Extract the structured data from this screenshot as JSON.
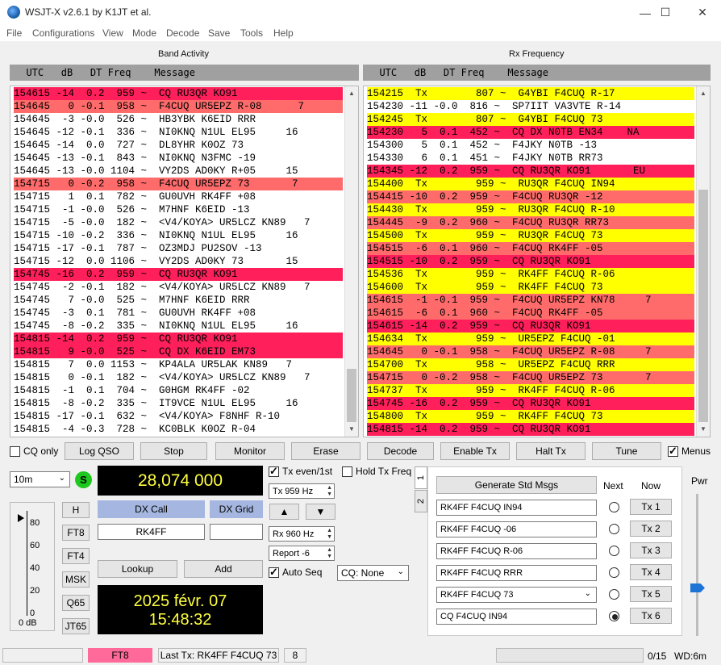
{
  "window": {
    "title": "WSJT-X   v2.6.1   by K1JT et al."
  },
  "menu": [
    "File",
    "Configurations",
    "View",
    "Mode",
    "Decode",
    "Save",
    "Tools",
    "Help"
  ],
  "band_activity": {
    "title": "Band Activity",
    "header": "  UTC   dB   DT Freq    Message",
    "rows": [
      {
        "text": "154615 -14  0.2  959 ~  CQ RU3QR KO91",
        "bg": "#ff1f5a"
      },
      {
        "text": "154645   0 -0.1  958 ~  F4CUQ UR5EPZ R-08      7",
        "bg": "#ff6b6b"
      },
      {
        "text": "154645  -3 -0.0  526 ~  HB3YBK K6EID RRR",
        "bg": "#ffffff"
      },
      {
        "text": "154645 -12 -0.1  336 ~  NI0KNQ N1UL EL95     16",
        "bg": "#ffffff"
      },
      {
        "text": "154645 -14  0.0  727 ~  DL8YHR K0OZ 73",
        "bg": "#ffffff"
      },
      {
        "text": "154645 -13 -0.1  843 ~  NI0KNQ N3FMC -19",
        "bg": "#ffffff"
      },
      {
        "text": "154645 -13 -0.0 1104 ~  VY2DS AD0KY R+05     15",
        "bg": "#ffffff"
      },
      {
        "text": "154715   0 -0.2  958 ~  F4CUQ UR5EPZ 73       7",
        "bg": "#ff6b6b"
      },
      {
        "text": "154715   1  0.1  782 ~  GU0UVH RK4FF +08",
        "bg": "#ffffff"
      },
      {
        "text": "154715  -1 -0.0  526 ~  M7HNF K6EID -13",
        "bg": "#ffffff"
      },
      {
        "text": "154715  -5 -0.0  182 ~  <V4/KOYA> UR5LCZ KN89   7",
        "bg": "#ffffff"
      },
      {
        "text": "154715 -10 -0.2  336 ~  NI0KNQ N1UL EL95     16",
        "bg": "#ffffff"
      },
      {
        "text": "154715 -17 -0.1  787 ~  OZ3MDJ PU2SOV -13",
        "bg": "#ffffff"
      },
      {
        "text": "154715 -12  0.0 1106 ~  VY2DS AD0KY 73       15",
        "bg": "#ffffff"
      },
      {
        "text": "154745 -16  0.2  959 ~  CQ RU3QR KO91",
        "bg": "#ff1f5a"
      },
      {
        "text": "154745  -2 -0.1  182 ~  <V4/KOYA> UR5LCZ KN89   7",
        "bg": "#ffffff"
      },
      {
        "text": "154745   7 -0.0  525 ~  M7HNF K6EID RRR",
        "bg": "#ffffff"
      },
      {
        "text": "154745  -3  0.1  781 ~  GU0UVH RK4FF +08",
        "bg": "#ffffff"
      },
      {
        "text": "154745  -8 -0.2  335 ~  NI0KNQ N1UL EL95     16",
        "bg": "#ffffff"
      },
      {
        "text": "154815 -14  0.2  959 ~  CQ RU3QR KO91",
        "bg": "#ff1f5a"
      },
      {
        "text": "154815   9 -0.0  525 ~  CQ DX K6EID EM73",
        "bg": "#ff1f5a"
      },
      {
        "text": "154815   7  0.0 1153 ~  KP4ALA UR5LAK KN89   7",
        "bg": "#ffffff"
      },
      {
        "text": "154815   0 -0.1  182 ~  <V4/KOYA> UR5LCZ KN89   7",
        "bg": "#ffffff"
      },
      {
        "text": "154815  -1  0.1  704 ~  G0HGM RK4FF -02",
        "bg": "#ffffff"
      },
      {
        "text": "154815  -8 -0.2  335 ~  IT9VCE N1UL EL95     16",
        "bg": "#ffffff"
      },
      {
        "text": "154815 -17 -0.1  632 ~  <V4/KOYA> F8NHF R-10",
        "bg": "#ffffff"
      },
      {
        "text": "154815  -4 -0.3  728 ~  KC0BLK K0OZ R-04",
        "bg": "#ffffff"
      }
    ]
  },
  "rx_frequency": {
    "title": "Rx Frequency",
    "header": "  UTC   dB   DT Freq    Message",
    "rows": [
      {
        "text": "154215  Tx        807 ~  G4YBI F4CUQ R-17",
        "bg": "#ffff00"
      },
      {
        "text": "154230 -11 -0.0  816 ~  SP7IIT VA3VTE R-14",
        "bg": "#ffffff"
      },
      {
        "text": "154245  Tx        807 ~  G4YBI F4CUQ 73",
        "bg": "#ffff00"
      },
      {
        "text": "154230   5  0.1  452 ~  CQ DX N0TB EN34    NA",
        "bg": "#ff1f5a"
      },
      {
        "text": "154300   5  0.1  452 ~  F4JKY N0TB -13",
        "bg": "#ffffff"
      },
      {
        "text": "154330   6  0.1  451 ~  F4JKY N0TB RR73",
        "bg": "#ffffff"
      },
      {
        "text": "154345 -12  0.2  959 ~  CQ RU3QR KO91       EU",
        "bg": "#ff1f5a"
      },
      {
        "text": "154400  Tx        959 ~  RU3QR F4CUQ IN94",
        "bg": "#ffff00"
      },
      {
        "text": "154415 -10  0.2  959 ~  F4CUQ RU3QR -12",
        "bg": "#ff6b6b"
      },
      {
        "text": "154430  Tx        959 ~  RU3QR F4CUQ R-10",
        "bg": "#ffff00"
      },
      {
        "text": "154445  -9  0.2  960 ~  F4CUQ RU3QR RR73",
        "bg": "#ff6b6b"
      },
      {
        "text": "154500  Tx        959 ~  RU3QR F4CUQ 73",
        "bg": "#ffff00"
      },
      {
        "text": "154515  -6  0.1  960 ~  F4CUQ RK4FF -05",
        "bg": "#ff6b6b"
      },
      {
        "text": "154515 -10  0.2  959 ~  CQ RU3QR KO91",
        "bg": "#ff1f5a"
      },
      {
        "text": "154536  Tx        959 ~  RK4FF F4CUQ R-06",
        "bg": "#ffff00"
      },
      {
        "text": "154600  Tx        959 ~  RK4FF F4CUQ 73",
        "bg": "#ffff00"
      },
      {
        "text": "154615  -1 -0.1  959 ~  F4CUQ UR5EPZ KN78     7",
        "bg": "#ff6b6b"
      },
      {
        "text": "154615  -6  0.1  960 ~  F4CUQ RK4FF -05",
        "bg": "#ff6b6b"
      },
      {
        "text": "154615 -14  0.2  959 ~  CQ RU3QR KO91",
        "bg": "#ff1f5a"
      },
      {
        "text": "154634  Tx        959 ~  UR5EPZ F4CUQ -01",
        "bg": "#ffff00"
      },
      {
        "text": "154645   0 -0.1  958 ~  F4CUQ UR5EPZ R-08     7",
        "bg": "#ff6b6b"
      },
      {
        "text": "154700  Tx        958 ~  UR5EPZ F4CUQ RRR",
        "bg": "#ffff00"
      },
      {
        "text": "154715   0 -0.2  958 ~  F4CUQ UR5EPZ 73       7",
        "bg": "#ff6b6b"
      },
      {
        "text": "154737  Tx        959 ~  RK4FF F4CUQ R-06",
        "bg": "#ffff00"
      },
      {
        "text": "154745 -16  0.2  959 ~  CQ RU3QR KO91",
        "bg": "#ff1f5a"
      },
      {
        "text": "154800  Tx        959 ~  RK4FF F4CUQ 73",
        "bg": "#ffff00"
      },
      {
        "text": "154815 -14  0.2  959 ~  CQ RU3QR KO91",
        "bg": "#ff1f5a"
      }
    ]
  },
  "controls": {
    "cq_only": "CQ only",
    "log_qso": "Log QSO",
    "stop": "Stop",
    "monitor": "Monitor",
    "erase": "Erase",
    "decode": "Decode",
    "enable_tx": "Enable Tx",
    "halt_tx": "Halt Tx",
    "tune": "Tune",
    "menus": "Menus"
  },
  "left": {
    "band": "10m",
    "s_label": "S",
    "frequency": "28,074 000",
    "dx_call_label": "DX Call",
    "dx_grid_label": "DX Grid",
    "dx_call_value": "RK4FF",
    "dx_grid_value": "",
    "lookup": "Lookup",
    "add": "Add",
    "date": "2025 févr. 07",
    "time": "15:48:32",
    "modes": [
      "H",
      "FT8",
      "FT4",
      "MSK",
      "Q65",
      "JT65"
    ],
    "meter_ticks": [
      "80",
      "60",
      "40",
      "20",
      "0"
    ],
    "meter_label": "0 dB"
  },
  "middle": {
    "tx_even": "Tx even/1st",
    "hold_tx_freq": "Hold Tx Freq",
    "tx_freq": "Tx  959  Hz",
    "rx_freq": "Rx  960  Hz",
    "report": "Report -6",
    "auto_seq": "Auto Seq",
    "cq_select": "CQ: None",
    "up_arrow": "▲",
    "down_arrow": "▼"
  },
  "tx_panel": {
    "tab1": "1",
    "tab2": "2",
    "generate": "Generate Std Msgs",
    "next_label": "Next",
    "now_label": "Now",
    "messages": [
      {
        "text": "RK4FF F4CUQ IN94",
        "button": "Tx 1"
      },
      {
        "text": "RK4FF F4CUQ -06",
        "button": "Tx 2"
      },
      {
        "text": "RK4FF F4CUQ R-06",
        "button": "Tx 3"
      },
      {
        "text": "RK4FF F4CUQ RRR",
        "button": "Tx 4"
      },
      {
        "text": "RK4FF F4CUQ 73",
        "button": "Tx 5"
      },
      {
        "text": "CQ F4CUQ IN94",
        "button": "Tx 6"
      }
    ],
    "selected_next": 5,
    "pwr_label": "Pwr"
  },
  "status": {
    "mode": "FT8",
    "last_tx": "Last Tx: RK4FF F4CUQ 73",
    "count": "8",
    "progress": "0/15",
    "wd": "WD:6m"
  },
  "colors": {
    "cq_row": "#ff1f5a",
    "mycall_row": "#ff6b6b",
    "tx_row": "#ffff00",
    "mode_badge": "#ff6a9a",
    "dx_header": "#a5b7e1",
    "digital_text": "#ffff40"
  }
}
